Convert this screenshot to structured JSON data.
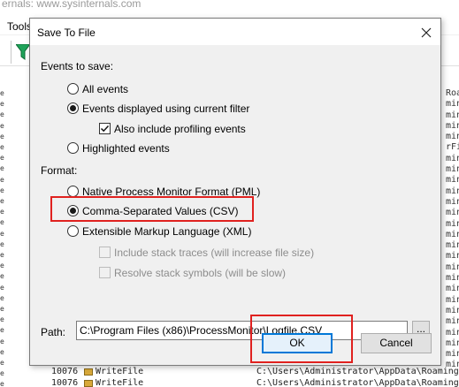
{
  "background_app": {
    "title_fragment": "ernals: www.sysinternals.com",
    "menu_tools": "Tools",
    "rows": [
      {
        "pid": "10076",
        "op": "WriteFile",
        "path": "C:\\Users\\Administrator\\AppData\\Roaming"
      },
      {
        "pid": "10076",
        "op": "WriteFile",
        "path": "C:\\Users\\Administrator\\AppData\\Roaming"
      }
    ],
    "right_col_text": "Roaming\nming\nming\nming\nming\nrFil\nming\nming\nming\nming\nming\nming\nming\nming\nming\nming\nming\nming\nming\nming\nming\nming\nming\nming\nming\nming",
    "left_col_text": "e\ne\ne\ne\ne\ne\ne\ne\ne\ne\ne\ne\ne\ne\ne\ne\ne\ne\ne\ne\ne\ne\ne\ne\ne\ne\ne\ne"
  },
  "dialog": {
    "title": "Save To File",
    "events_label": "Events to save:",
    "events_options": {
      "all": "All events",
      "filtered": "Events displayed using current filter",
      "profiling": "Also include profiling events",
      "highlighted": "Highlighted events"
    },
    "selected_event_option": "Events displayed using current filter",
    "profiling_checked": true,
    "format_label": "Format:",
    "format_options": {
      "pml": "Native Process Monitor Format (PML)",
      "csv": "Comma-Separated Values (CSV)",
      "xml": "Extensible Markup Language (XML)",
      "stack_traces": "Include stack traces (will increase file size)",
      "resolve_symbols": "Resolve stack symbols (will be slow)"
    },
    "selected_format": "Comma-Separated Values (CSV)",
    "path_label": "Path:",
    "path_value": "C:\\Program Files (x86)\\ProcessMonitor\\Logfile.CSV",
    "browse_label": "...",
    "ok_label": "OK",
    "cancel_label": "Cancel"
  },
  "colors": {
    "highlight": "#e0211f",
    "dialog_bg": "#f0f0f0",
    "default_button_border": "#0078d7"
  }
}
